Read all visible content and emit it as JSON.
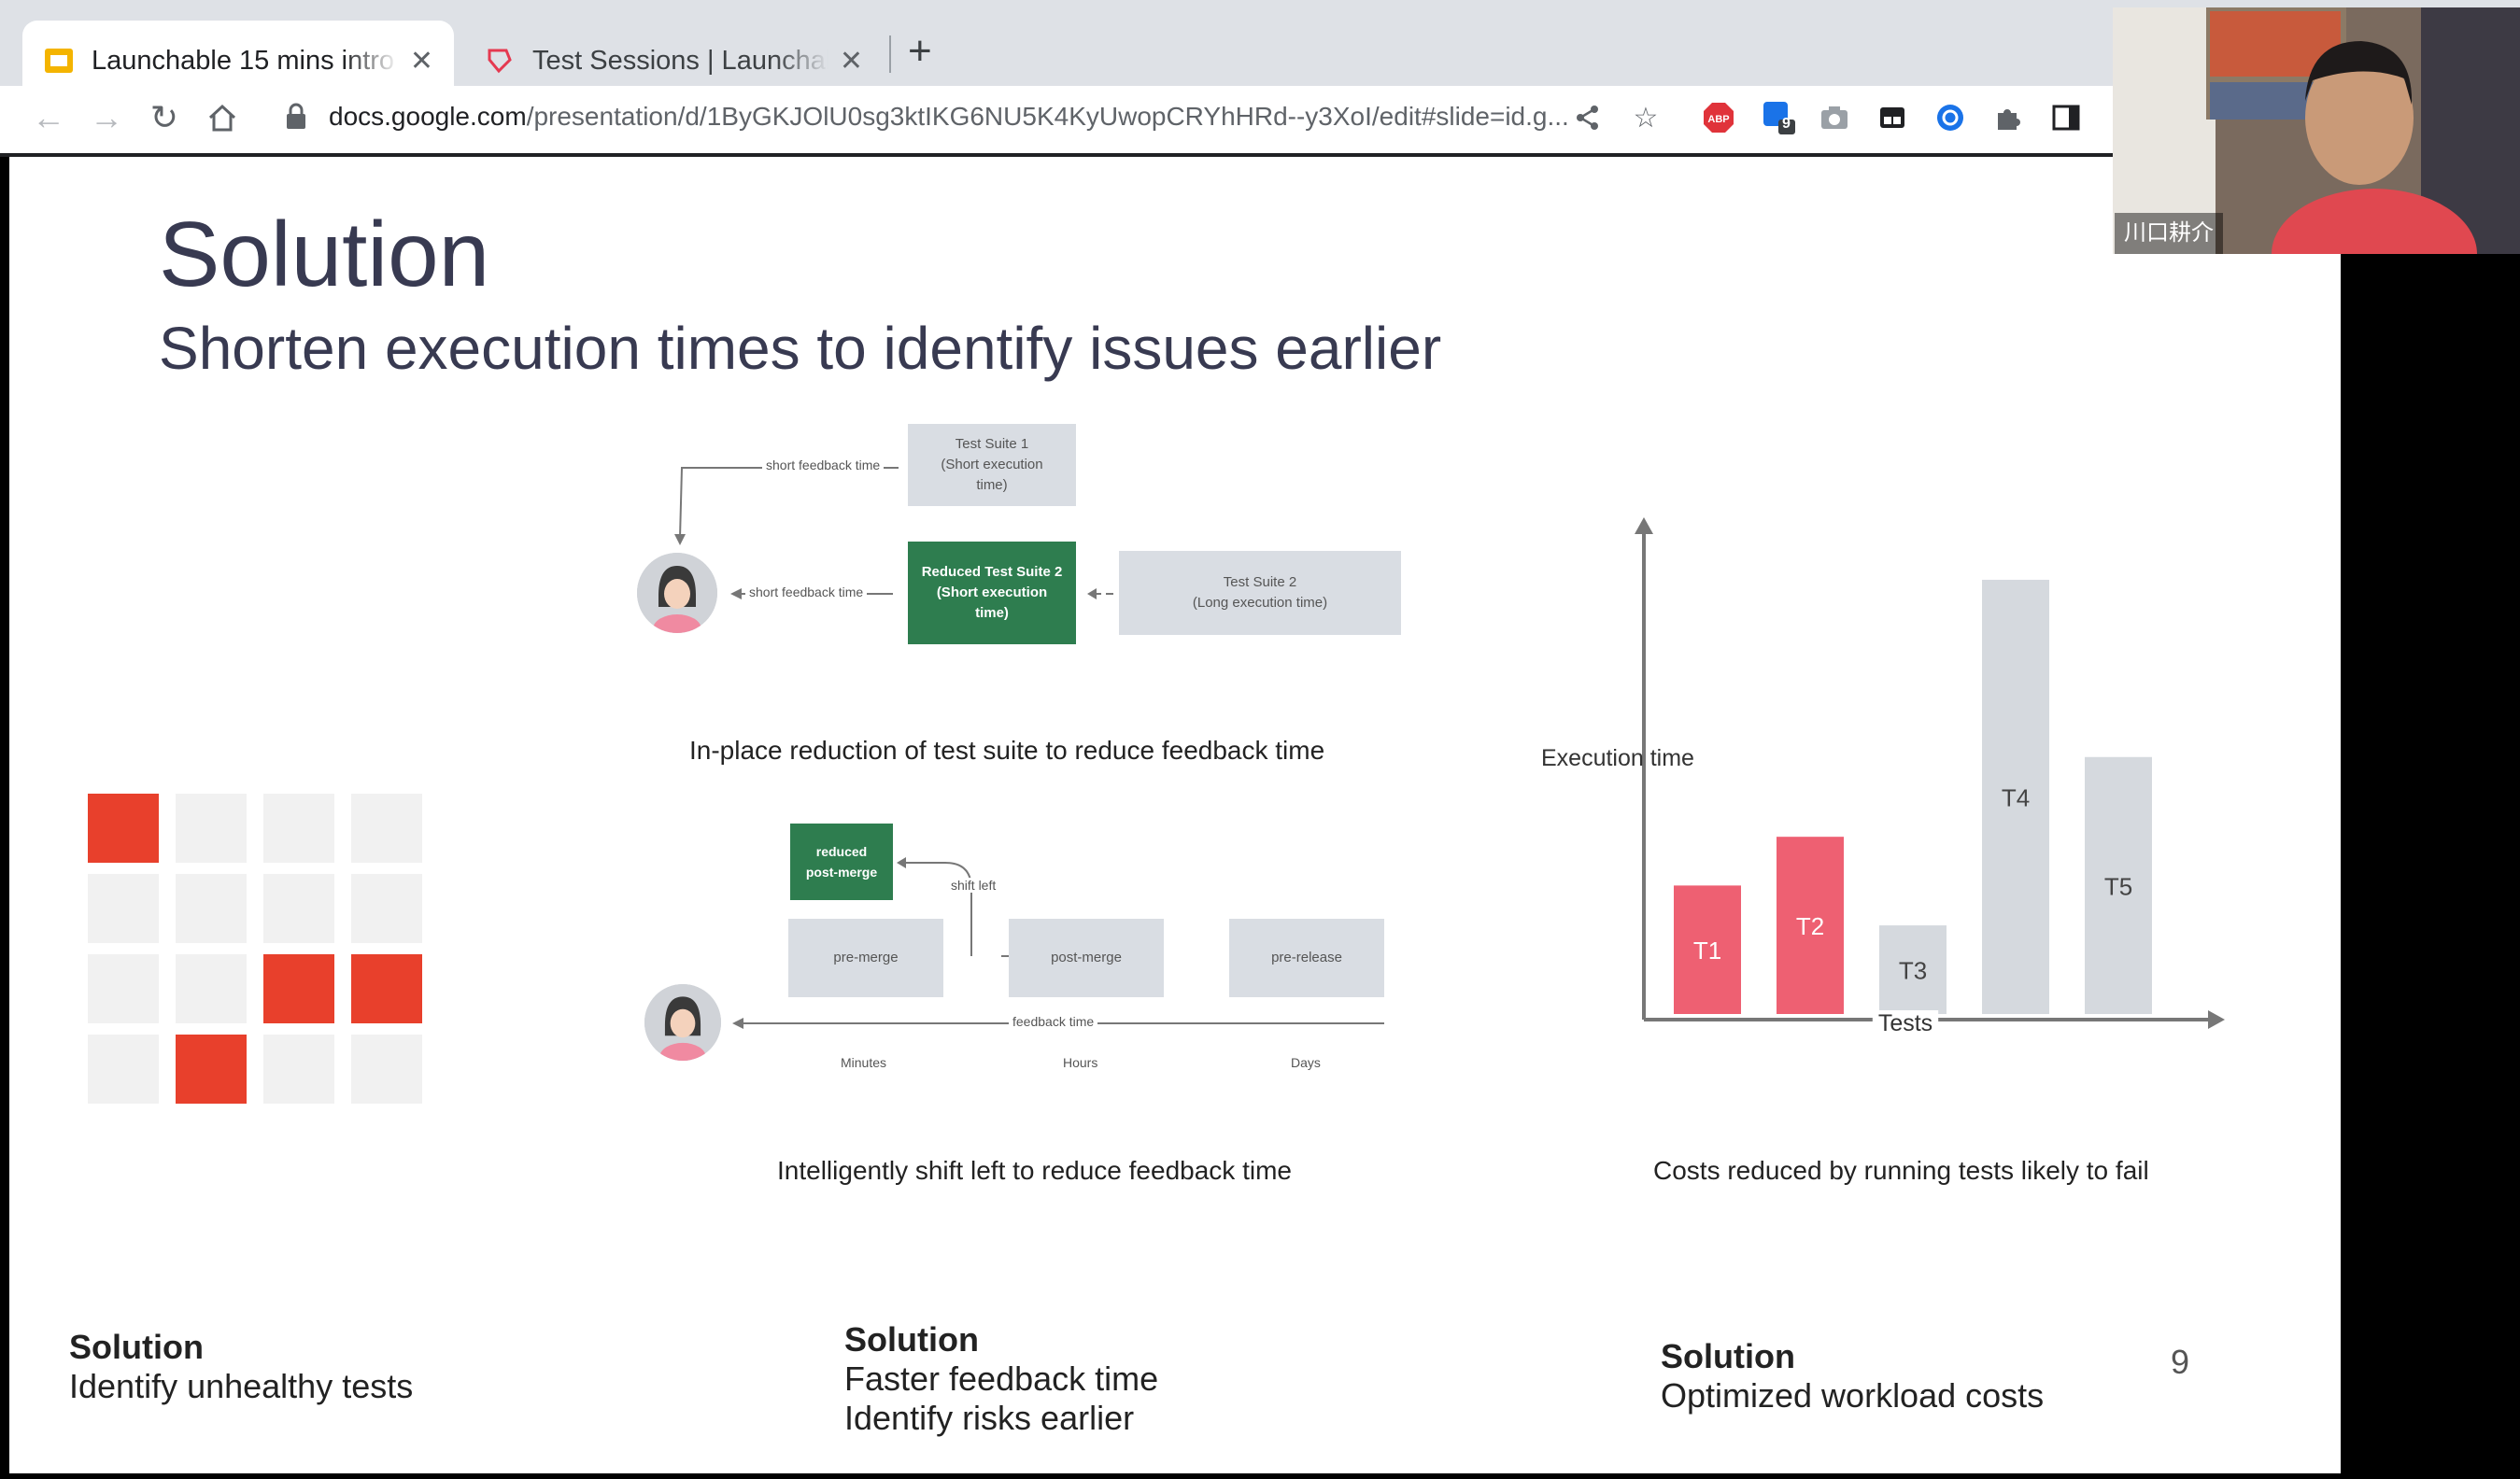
{
  "browser": {
    "tabs": [
      {
        "title": "Launchable 15 mins intro",
        "active": true,
        "icon": "google-slides-icon"
      },
      {
        "title": "Test Sessions | Launchable",
        "active": false,
        "icon": "launchable-icon"
      }
    ],
    "url_host": "docs.google.com",
    "url_path": "/presentation/d/1ByGKJOlU0sg3ktIKG6NU5K4KyUwopCRYhHRd--y3XoI/edit#slide=id.g...",
    "extension_badge": "9"
  },
  "slide": {
    "title": "Solution",
    "subtitle": "Shorten execution times to identify issues earlier",
    "diagram1": {
      "suite1": "Test Suite 1\n(Short execution\ntime)",
      "reduced": "Reduced Test Suite 2\n(Short execution\ntime)",
      "suite2": "Test Suite 2\n(Long execution time)",
      "label_top": "short feedback time",
      "label_mid": "short feedback time",
      "caption": "In-place reduction of test suite to reduce feedback time"
    },
    "diagram2": {
      "reduced": "reduced\npost-merge",
      "shift": "shift left",
      "premerge": "pre-merge",
      "postmerge": "post-merge",
      "prerelease": "pre-release",
      "feedback": "feedback time",
      "t1": "Minutes",
      "t2": "Hours",
      "t3": "Days",
      "caption": "Intelligently shift left to reduce feedback time"
    },
    "chart_caption": "Costs reduced by running tests likely to fail",
    "solutions": [
      {
        "heading": "Solution",
        "lines": [
          "Identify unhealthy tests"
        ]
      },
      {
        "heading": "Solution",
        "lines": [
          "Faster feedback time",
          "Identify risks earlier"
        ]
      },
      {
        "heading": "Solution",
        "lines": [
          "Optimized workload costs"
        ]
      }
    ],
    "page_number": "9",
    "heatmap": [
      [
        1,
        0,
        0,
        0
      ],
      [
        0,
        0,
        0,
        0
      ],
      [
        0,
        0,
        1,
        1
      ],
      [
        0,
        1,
        0,
        0
      ]
    ],
    "colors": {
      "hot": "#e8402c",
      "pink": "#ee6072",
      "grey": "#d5d9de",
      "green": "#2e7d4f"
    }
  },
  "chart_data": {
    "type": "bar",
    "categories": [
      "T1",
      "T2",
      "T3",
      "T4",
      "T5"
    ],
    "values": [
      145,
      200,
      100,
      490,
      290
    ],
    "highlighted": [
      "T1",
      "T2"
    ],
    "xlabel": "Tests",
    "ylabel": "Execution time"
  },
  "webcam": {
    "name": "川口耕介"
  }
}
